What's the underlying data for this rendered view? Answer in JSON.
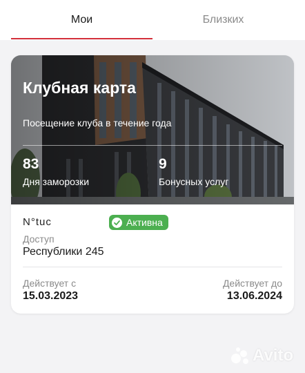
{
  "tabs": [
    {
      "label": "Мои",
      "active": true
    },
    {
      "label": "Близких",
      "active": false
    }
  ],
  "card": {
    "title": "Клубная карта",
    "subtitle": "Посещение клуба в течение года",
    "stats": [
      {
        "value": "83",
        "label": "Дня заморозки"
      },
      {
        "value": "9",
        "label": "Бонусных услуг"
      }
    ],
    "name": "N°tuc",
    "status": "Активна",
    "access_label": "Доступ",
    "access_value": "Республики 245",
    "valid_from_label": "Действует с",
    "valid_from": "15.03.2023",
    "valid_to_label": "Действует до",
    "valid_to": "13.06.2024"
  },
  "colors": {
    "accent": "#d32f3a",
    "badge": "#4caf50"
  },
  "icons": {
    "badge": "check-circle-icon"
  },
  "watermark": "Avito"
}
